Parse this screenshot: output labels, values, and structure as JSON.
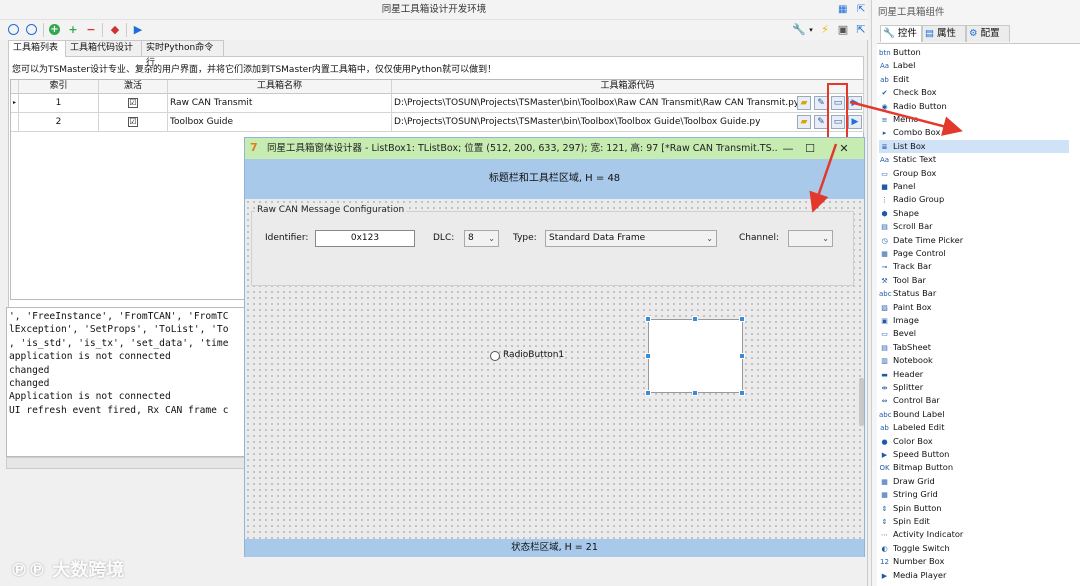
{
  "main": {
    "title": "同星工具箱设计开发环境",
    "tabs": [
      "工具箱列表",
      "工具箱代码设计",
      "实时Python命令行"
    ],
    "description": "您可以为TSMaster设计专业、复杂的用户界面，并将它们添加到TSMaster内置工具箱中，仅仅使用Python就可以做到！",
    "grid": {
      "columns": [
        "索引",
        "激活",
        "工具箱名称",
        "工具箱源代码"
      ],
      "rows": [
        {
          "index": "1",
          "active": "☑",
          "name": "Raw CAN Transmit",
          "path": "D:\\Projects\\TOSUN\\Projects\\TSMaster\\bin\\Toolbox\\Raw CAN Transmit\\Raw CAN Transmit.py"
        },
        {
          "index": "2",
          "active": "☑",
          "name": "Toolbox Guide",
          "path": "D:\\Projects\\TOSUN\\Projects\\TSMaster\\bin\\Toolbox\\Toolbox Guide\\Toolbox Guide.py"
        }
      ]
    },
    "log_lines": [
      "', 'FreeInstance', 'FromTCAN', 'FromTC",
      "lException', 'SetProps', 'ToList', 'To",
      ", 'is_std', 'is_tx', 'set_data', 'time",
      "application is not connected",
      "changed",
      "changed",
      "Application is not connected",
      "UI refresh event fired, Rx CAN frame c"
    ]
  },
  "designer": {
    "title": "同星工具箱窗体设计器 - ListBox1: TListBox; 位置 (512, 200, 633, 297); 宽: 121, 高: 97 [*Raw CAN Transmit.TS...",
    "header_text": "标题栏和工具栏区域, H = 48",
    "group_caption": "Raw CAN Message Configuration",
    "identifier_label": "Identifier:",
    "identifier_value": "0x123",
    "dlc_label": "DLC:",
    "dlc_value": "8",
    "type_label": "Type:",
    "type_value": "Standard Data Frame",
    "channel_label": "Channel:",
    "channel_value": "",
    "radio_label": "RadioButton1",
    "footer_text": "状态栏区域, H = 21"
  },
  "palette": {
    "title": "同星工具箱组件",
    "tabs": [
      "控件",
      "属性",
      "配置"
    ],
    "selected": "List Box",
    "items": [
      "Button",
      "Label",
      "Edit",
      "Check Box",
      "Radio Button",
      "Memo",
      "Combo Box",
      "List Box",
      "Static Text",
      "Group Box",
      "Panel",
      "Radio Group",
      "Shape",
      "Scroll Bar",
      "Date Time Picker",
      "Page Control",
      "Track Bar",
      "Tool Bar",
      "Status Bar",
      "Paint Box",
      "Image",
      "Bevel",
      "TabSheet",
      "Notebook",
      "Header",
      "Splitter",
      "Control Bar",
      "Bound Label",
      "Labeled Edit",
      "Color Box",
      "Speed Button",
      "Bitmap Button",
      "Draw Grid",
      "String Grid",
      "Spin Button",
      "Spin Edit",
      "Activity Indicator",
      "Toggle Switch",
      "Number Box",
      "Media Player"
    ]
  },
  "watermark": "大数跨境",
  "colors": {
    "highlight": "#e3382b",
    "designer_title": "#c7ecb2",
    "area_bands": "#a8c9ea",
    "selection": "#cfe2f7"
  }
}
